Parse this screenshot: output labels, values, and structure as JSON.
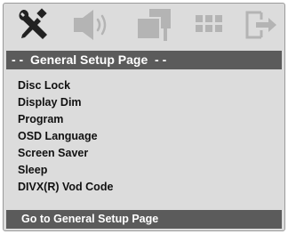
{
  "icons": [
    "tools-icon",
    "speaker-icon",
    "display-icon",
    "preference-icon",
    "exit-icon"
  ],
  "header": {
    "title": "- -  General Setup Page  - -"
  },
  "menu_items": [
    {
      "label": "Disc Lock"
    },
    {
      "label": "Display Dim"
    },
    {
      "label": "Program"
    },
    {
      "label": "OSD Language"
    },
    {
      "label": "Screen Saver"
    },
    {
      "label": "Sleep"
    },
    {
      "label": "DIVX(R) Vod Code"
    }
  ],
  "footer": {
    "hint": "Go to General Setup Page"
  },
  "colors": {
    "panel": "#dcdcdc",
    "bar": "#5b5b5b",
    "icon_active": "#222222",
    "icon_inactive": "#b4b4b4"
  }
}
